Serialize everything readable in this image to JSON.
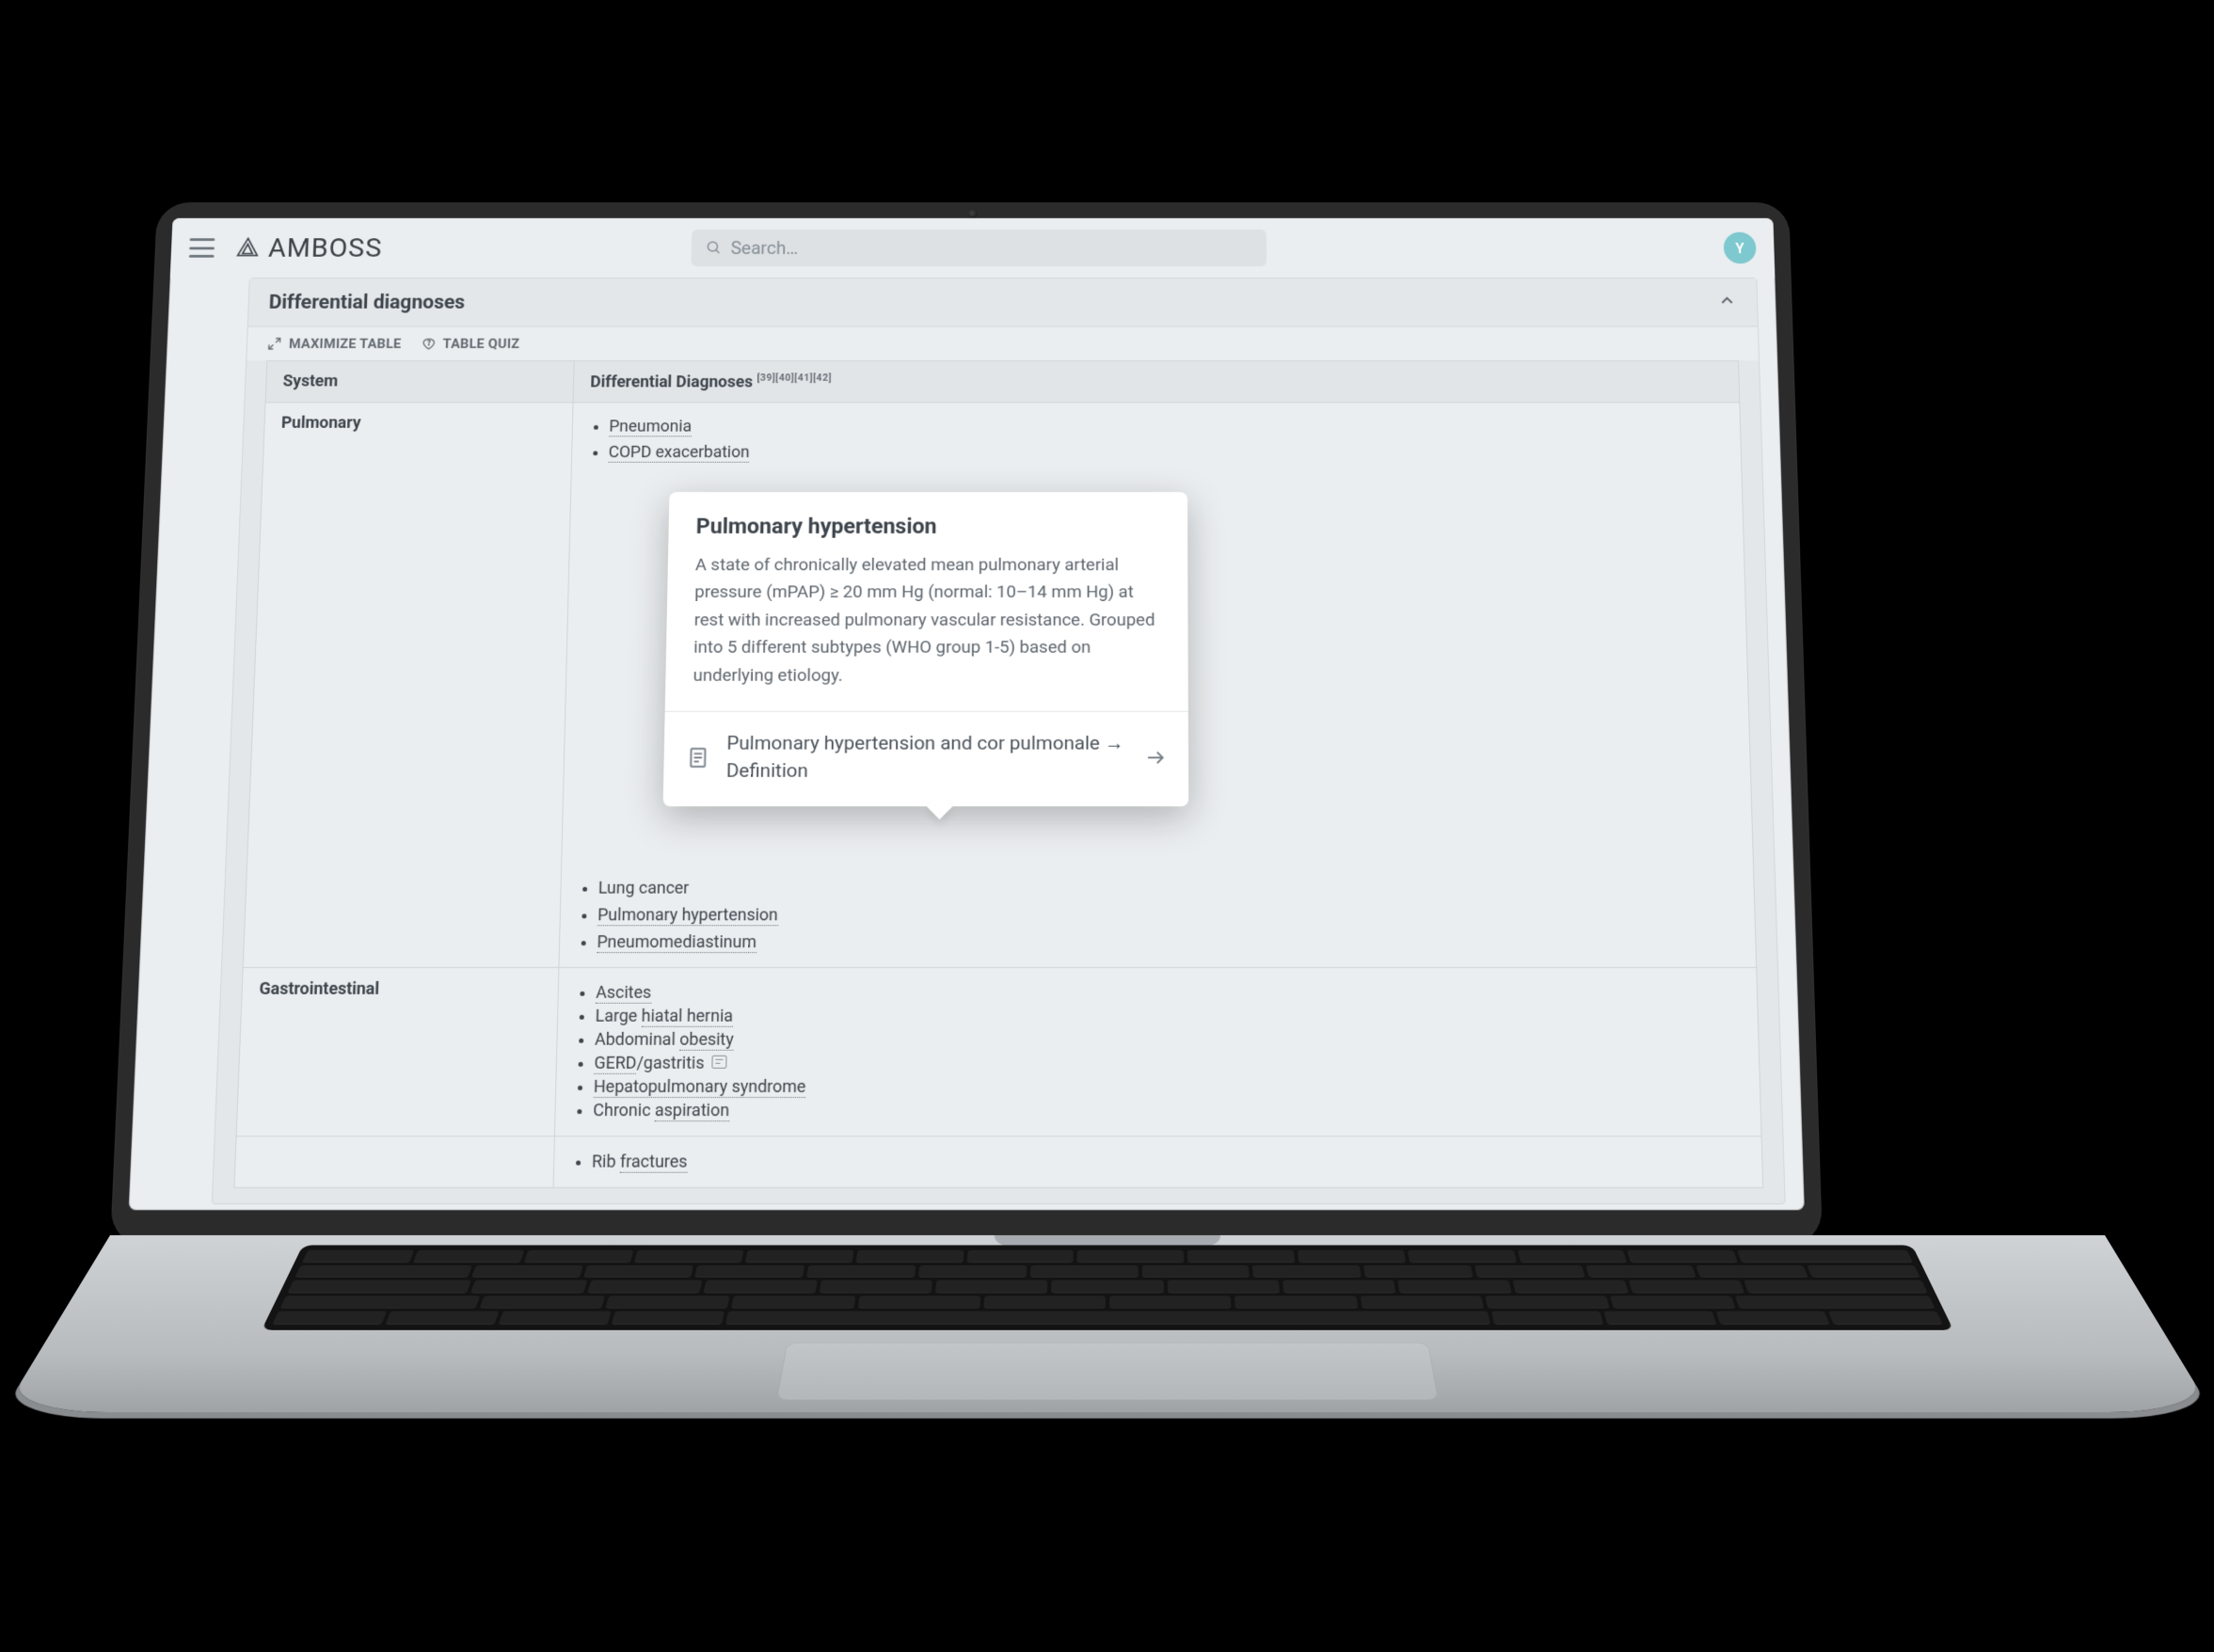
{
  "brand": "AMBOSS",
  "search": {
    "placeholder": "Search…"
  },
  "avatar_initial": "Y",
  "panel": {
    "title": "Differential diagnoses",
    "tools": {
      "maximize": "MAXIMIZE TABLE",
      "quiz": "TABLE QUIZ"
    },
    "headers": {
      "system": "System",
      "dd": "Differential Diagnoses",
      "refs": "[39][40][41][42]"
    },
    "rows": [
      {
        "system": "Pulmonary",
        "items": [
          {
            "label": "Pneumonia",
            "link": true
          },
          {
            "label": "COPD exacerbation",
            "link": true
          },
          {
            "label": "Lung cancer",
            "link": false,
            "truncated": true
          },
          {
            "label": "Pulmonary hypertension",
            "link": true
          },
          {
            "label": "Pneumomediastinum",
            "link": true
          }
        ]
      },
      {
        "system": "Gastrointestinal",
        "items": [
          {
            "label": "Ascites",
            "link": true
          },
          {
            "label": "Large hiatal hernia",
            "link": true,
            "partial_label": "hiatal hernia",
            "prefix": "Large "
          },
          {
            "label": "Abdominal obesity",
            "link": true,
            "partial_label": "obesity",
            "prefix": "Abdominal "
          },
          {
            "label": "GERD/gastritis",
            "link": true,
            "partial_label": "GERD",
            "suffix": "/gastritis",
            "note_icon": true
          },
          {
            "label": "Hepatopulmonary syndrome",
            "link": true
          },
          {
            "label": "Chronic aspiration",
            "link": true,
            "partial_label": "aspiration",
            "prefix": "Chronic "
          }
        ]
      },
      {
        "system": "",
        "items": [
          {
            "label": "Rib fractures",
            "link": true,
            "partial_label": "fractures",
            "prefix": "Rib "
          }
        ],
        "truncated": true
      }
    ]
  },
  "popover": {
    "title": "Pulmonary hypertension",
    "body": "A state of chronically elevated mean pulmonary arterial pressure (mPAP) ≥ 20 mm Hg (normal: 10–14 mm Hg) at rest with increased pulmonary vascular resistance. Grouped into 5 different subtypes (WHO group 1-5) based on underlying etiology.",
    "link_label": "Pulmonary hypertension and cor pulmonale → Definition"
  }
}
